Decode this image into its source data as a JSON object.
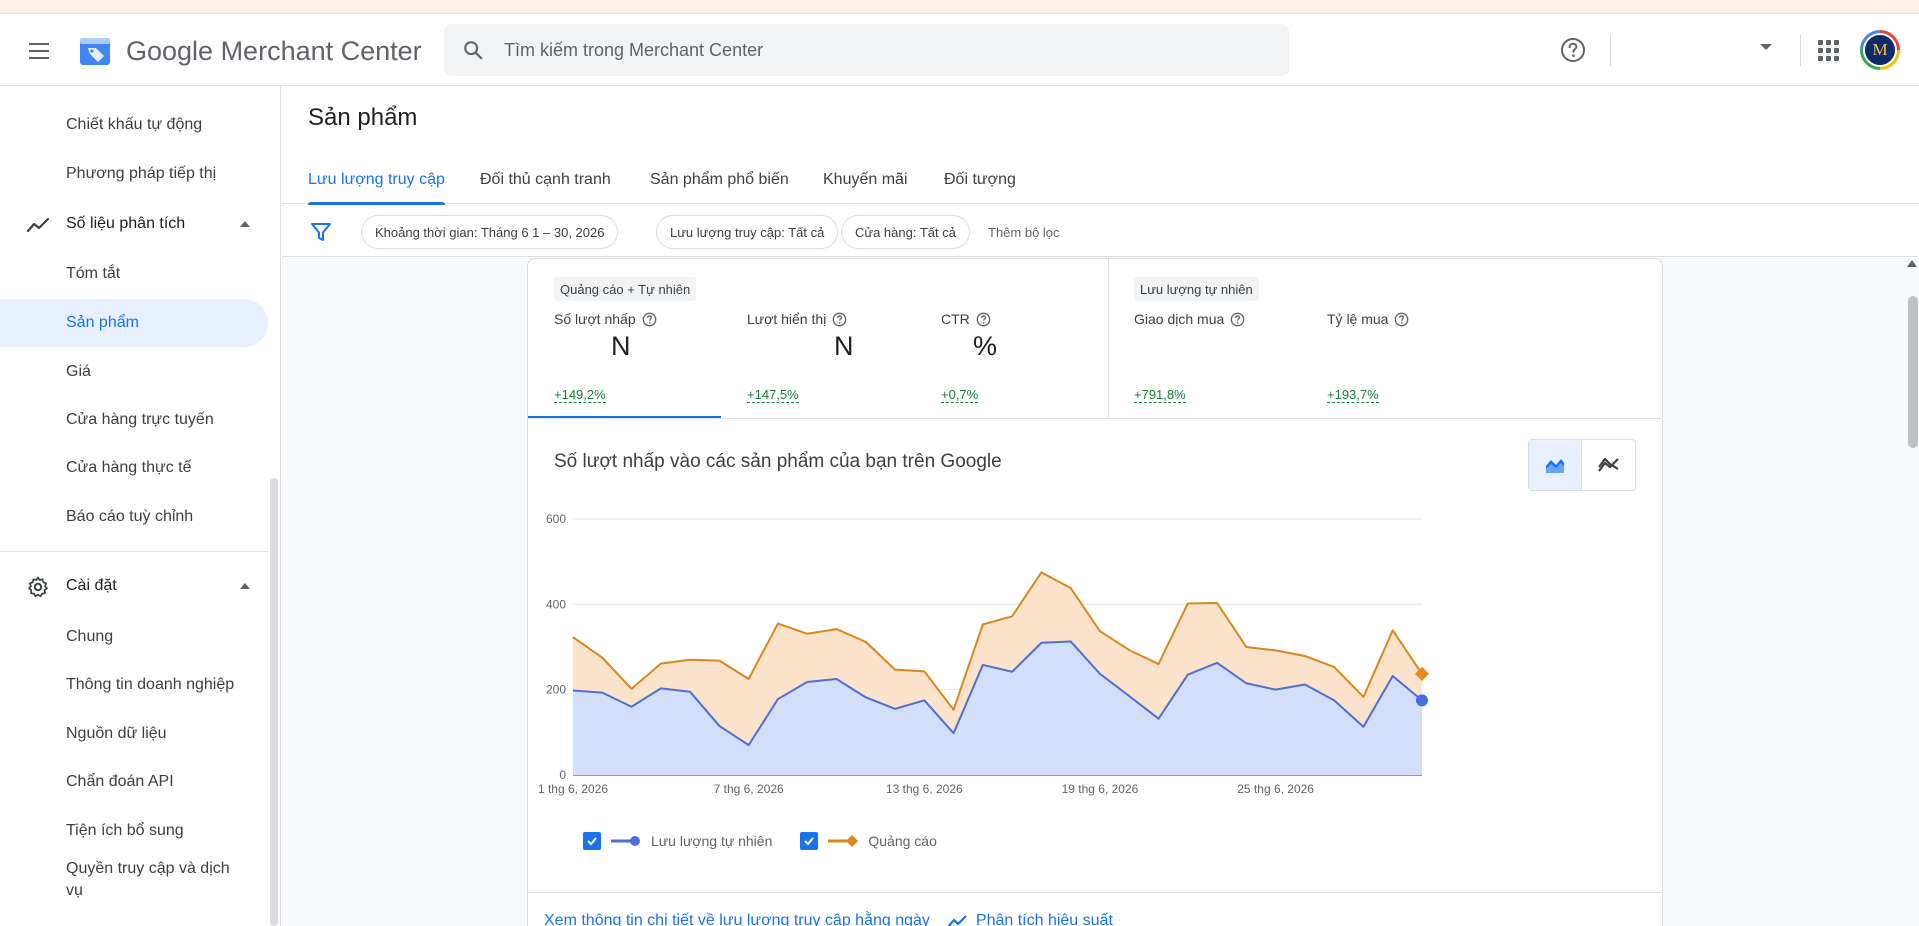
{
  "header": {
    "app_name": "Google Merchant Center",
    "search_placeholder": "Tìm kiếm trong Merchant Center",
    "avatar_initial": "M"
  },
  "sidebar": {
    "items": [
      {
        "label": "Chiết khấu tự động",
        "type": "sub"
      },
      {
        "label": "Phương pháp tiếp thị",
        "type": "sub"
      },
      {
        "label": "Số liệu phân tích",
        "type": "section",
        "icon": "trending-icon"
      },
      {
        "label": "Tóm tắt",
        "type": "sub"
      },
      {
        "label": "Sản phẩm",
        "type": "sub",
        "active": true
      },
      {
        "label": "Giá",
        "type": "sub"
      },
      {
        "label": "Cửa hàng trực tuyến",
        "type": "sub"
      },
      {
        "label": "Cửa hàng thực tế",
        "type": "sub"
      },
      {
        "label": "Báo cáo tuỳ chỉnh",
        "type": "sub"
      },
      {
        "label": "Cài đặt",
        "type": "section",
        "icon": "gear-icon"
      },
      {
        "label": "Chung",
        "type": "sub"
      },
      {
        "label": "Thông tin doanh nghiệp",
        "type": "sub"
      },
      {
        "label": "Nguồn dữ liệu",
        "type": "sub"
      },
      {
        "label": "Chẩn đoán API",
        "type": "sub"
      },
      {
        "label": "Tiện ích bổ sung",
        "type": "sub"
      },
      {
        "label": "Quyền truy cập và dịch vụ",
        "type": "sub"
      }
    ]
  },
  "main": {
    "page_title": "Sản phẩm",
    "tabs": [
      {
        "label": "Lưu lượng truy cập",
        "active": true
      },
      {
        "label": "Đối thủ cạnh tranh"
      },
      {
        "label": "Sản phẩm phổ biến"
      },
      {
        "label": "Khuyến mãi"
      },
      {
        "label": "Đối tượng"
      }
    ],
    "filters": {
      "chips": [
        "Khoảng thời gian: Tháng 6 1 – 30, 2026",
        "Lưu lượng truy cập: Tất cả",
        "Cửa hàng: Tất cả"
      ],
      "add_filter": "Thêm bộ lọc"
    },
    "metric_groups": [
      {
        "label": "Quảng cáo + Tự nhiên",
        "metrics": [
          {
            "label": "Số lượt nhấp",
            "value": "N",
            "change": "+149,2%"
          },
          {
            "label": "Lượt hiển thị",
            "value": "N",
            "change": "+147,5%"
          },
          {
            "label": "CTR",
            "value": "%",
            "change": "+0,7%"
          }
        ]
      },
      {
        "label": "Lưu lượng tự nhiên",
        "metrics": [
          {
            "label": "Giao dịch mua",
            "value": "",
            "change": "+791,8%"
          },
          {
            "label": "Tỷ lệ mua",
            "value": "",
            "change": "+193,7%"
          }
        ]
      }
    ],
    "chart_title": "Số lượt nhấp vào các sản phẩm của bạn trên Google",
    "footer_links": [
      "Xem thông tin chi tiết về lưu lượng truy cập hằng ngày",
      "Phân tích hiệu suất"
    ]
  },
  "chart_data": {
    "type": "area",
    "stacked": true,
    "x": [
      "1 thg 6, 2026",
      "2 thg 6, 2026",
      "3 thg 6, 2026",
      "4 thg 6, 2026",
      "5 thg 6, 2026",
      "6 thg 6, 2026",
      "7 thg 6, 2026",
      "8 thg 6, 2026",
      "9 thg 6, 2026",
      "10 thg 6, 2026",
      "11 thg 6, 2026",
      "12 thg 6, 2026",
      "13 thg 6, 2026",
      "14 thg 6, 2026",
      "15 thg 6, 2026",
      "16 thg 6, 2026",
      "17 thg 6, 2026",
      "18 thg 6, 2026",
      "19 thg 6, 2026",
      "20 thg 6, 2026",
      "21 thg 6, 2026",
      "22 thg 6, 2026",
      "23 thg 6, 2026",
      "24 thg 6, 2026",
      "25 thg 6, 2026",
      "26 thg 6, 2026",
      "27 thg 6, 2026",
      "28 thg 6, 2026",
      "29 thg 6, 2026",
      "30 thg 6, 2026"
    ],
    "x_tick_labels": [
      "1 thg 6, 2026",
      "7 thg 6, 2026",
      "13 thg 6, 2026",
      "19 thg 6, 2026",
      "25 thg 6, 2026"
    ],
    "x_tick_index": [
      0,
      6,
      12,
      18,
      24
    ],
    "yticks": [
      0,
      200,
      400,
      600
    ],
    "ylim": [
      0,
      600
    ],
    "grid": true,
    "legend_position": "bottom-left",
    "series": [
      {
        "name": "Lưu lượng tự nhiên",
        "color": "#4f6fd6",
        "fill": "#d3defa",
        "values": [
          198,
          193,
          160,
          203,
          195,
          115,
          70,
          178,
          218,
          225,
          182,
          155,
          175,
          98,
          258,
          242,
          310,
          313,
          237,
          185,
          132,
          235,
          263,
          215,
          200,
          212,
          175,
          113,
          232,
          175
        ]
      },
      {
        "name": "Quảng cáo",
        "color": "#d9871e",
        "fill": "#fbe3cb",
        "values": [
          125,
          82,
          42,
          58,
          75,
          153,
          155,
          177,
          113,
          117,
          130,
          92,
          68,
          55,
          95,
          130,
          165,
          125,
          100,
          108,
          128,
          167,
          140,
          85,
          92,
          67,
          78,
          70,
          107,
          62
        ]
      }
    ]
  }
}
